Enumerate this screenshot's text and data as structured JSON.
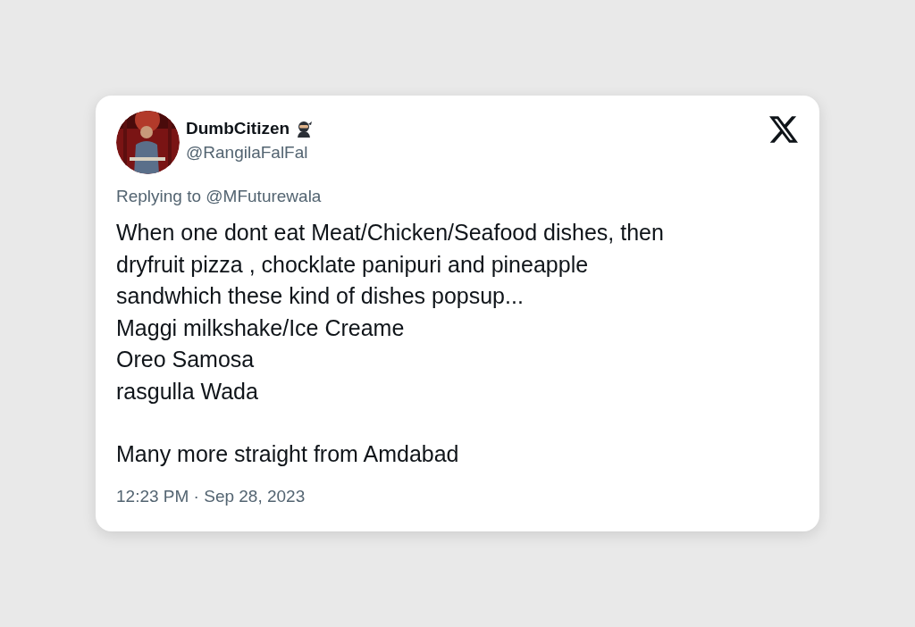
{
  "tweet": {
    "author": {
      "name": "DumbCitizen",
      "handle": "@RangilaFalFal"
    },
    "replying_to": "Replying to @MFuturewala",
    "paragraphs": [
      [
        "When one dont eat Meat/Chicken/Seafood dishes, then",
        "dryfruit pizza , chocklate panipuri and pineapple",
        "sandwhich these kind of dishes popsup...",
        "Maggi milkshake/Ice Creame",
        "Oreo Samosa",
        "rasgulla Wada"
      ],
      [
        "Many more straight from Amdabad"
      ]
    ],
    "timestamp": "12:23 PM · Sep 28, 2023"
  }
}
